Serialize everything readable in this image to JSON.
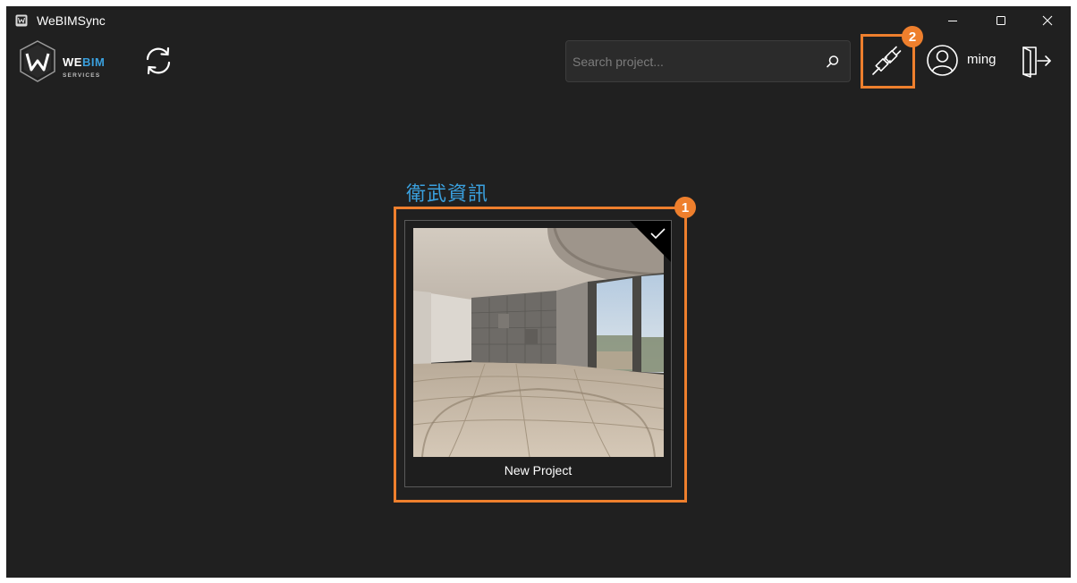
{
  "window": {
    "title": "WeBIMSync",
    "controls": {
      "minimize": "minimize-icon",
      "maximize": "maximize-icon",
      "close": "close-icon"
    }
  },
  "header": {
    "logo": {
      "brand_top": "WEBIM",
      "brand_bottom": "SERVICES"
    },
    "sync_icon": "sync-icon",
    "search": {
      "placeholder": "Search project...",
      "value": "",
      "icon": "search-icon"
    },
    "plugin_icon": "plug-icon",
    "user": {
      "name": "ming",
      "icon": "user-icon"
    },
    "logout_icon": "logout-icon"
  },
  "annotations": {
    "badge_1": "1",
    "badge_2": "2",
    "highlight_color": "#ee7f2d"
  },
  "content": {
    "group_title": "衛武資訊",
    "projects": [
      {
        "name": "New Project",
        "selected": true,
        "thumbnail": "panorama-room-interior"
      }
    ]
  },
  "colors": {
    "background": "#202020",
    "accent_blue": "#3aa0de",
    "annotation_orange": "#ee7f2d"
  }
}
